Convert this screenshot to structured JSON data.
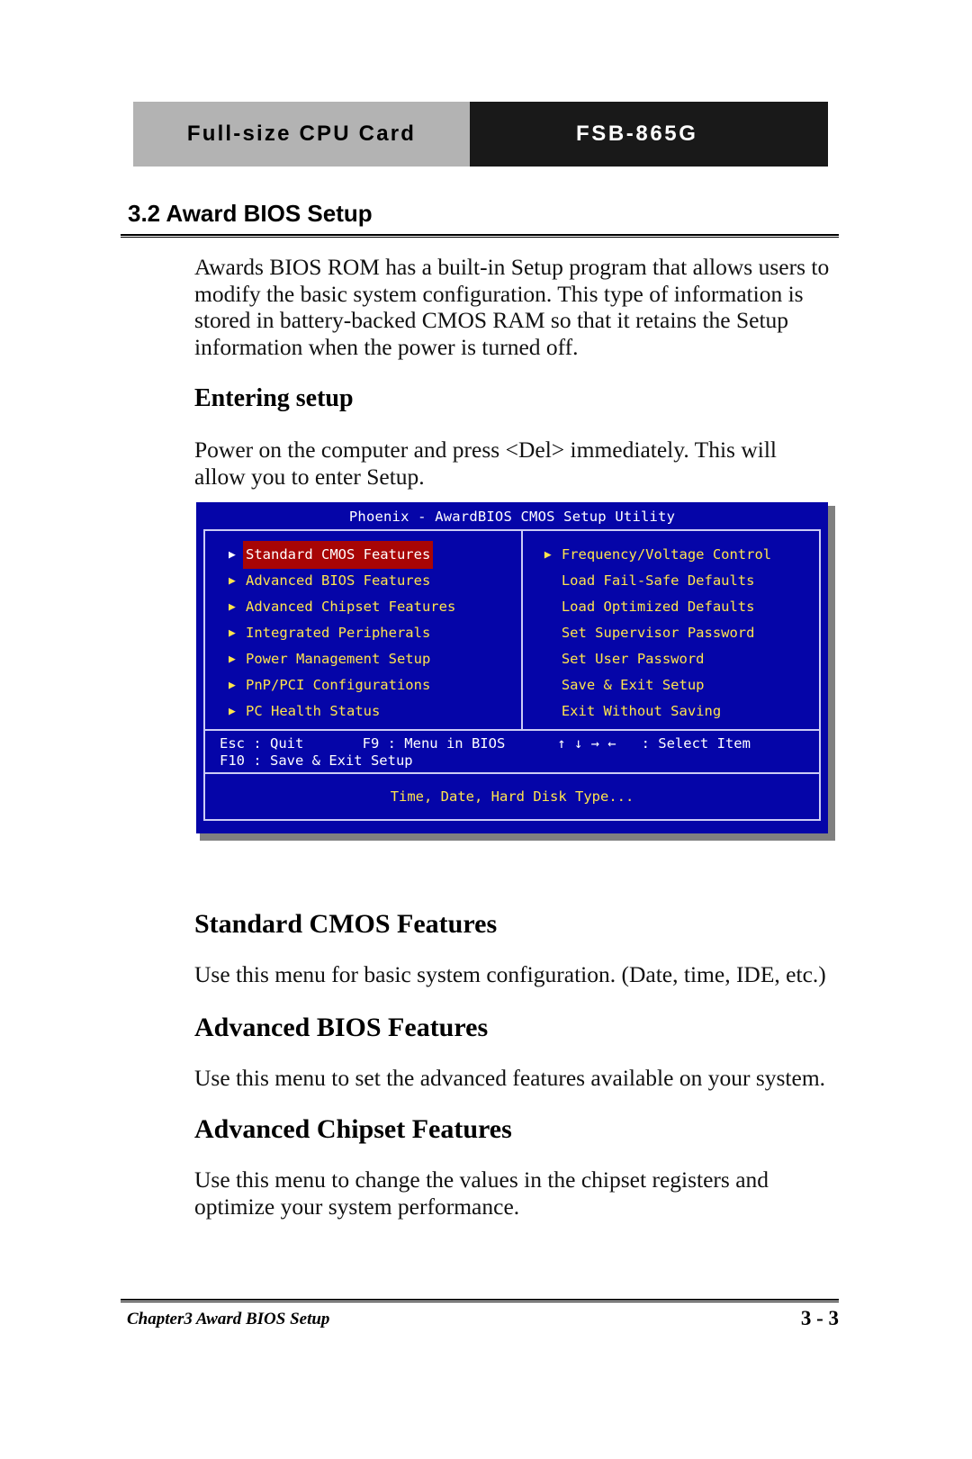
{
  "header": {
    "left_label": "Full-size CPU Card",
    "right_label": "FSB-865G",
    "left_bg": "#b3b3b3",
    "right_bg": "#191919"
  },
  "section": {
    "number_title": "3.2 Award BIOS Setup",
    "intro_paragraph": "Awards BIOS ROM has a built-in Setup program that allows users to modify the basic system configuration. This type of information is stored in battery-backed CMOS RAM so that it retains the Setup information when the power is turned off."
  },
  "entering_setup": {
    "heading": "Entering setup",
    "paragraph": "Power on the computer and press <Del> immediately. This will allow you to enter Setup."
  },
  "bios_screen": {
    "title": "Phoenix - AwardBIOS CMOS Setup Utility",
    "selected_item": "Standard CMOS Features",
    "colors": {
      "background": "#0505a8",
      "border": "#ccccf5",
      "item_text": "#ffe44d",
      "highlight_bg": "#a80505",
      "highlight_text": "#ffffff",
      "help_text": "#ffffff"
    },
    "left_column": [
      {
        "label": "Standard CMOS Features",
        "arrow": true,
        "selected": true
      },
      {
        "label": "Advanced BIOS Features",
        "arrow": true,
        "selected": false
      },
      {
        "label": "Advanced Chipset Features",
        "arrow": true,
        "selected": false
      },
      {
        "label": "Integrated Peripherals",
        "arrow": true,
        "selected": false
      },
      {
        "label": "Power Management Setup",
        "arrow": true,
        "selected": false
      },
      {
        "label": "PnP/PCI Configurations",
        "arrow": true,
        "selected": false
      },
      {
        "label": "PC Health Status",
        "arrow": true,
        "selected": false
      }
    ],
    "right_column": [
      {
        "label": "Frequency/Voltage Control",
        "arrow": true,
        "selected": false
      },
      {
        "label": "Load Fail-Safe Defaults",
        "arrow": false,
        "selected": false
      },
      {
        "label": "Load Optimized Defaults",
        "arrow": false,
        "selected": false
      },
      {
        "label": "Set Supervisor Password",
        "arrow": false,
        "selected": false
      },
      {
        "label": "Set User Password",
        "arrow": false,
        "selected": false
      },
      {
        "label": "Save & Exit Setup",
        "arrow": false,
        "selected": false
      },
      {
        "label": "Exit Without Saving",
        "arrow": false,
        "selected": false
      }
    ],
    "help_line_1": "Esc : Quit       F9 : Menu in BIOS",
    "help_line_2": "F10 : Save & Exit Setup",
    "help_keys": "↑ ↓ → ←   : Select Item",
    "description": "Time, Date, Hard Disk Type..."
  },
  "topics": [
    {
      "heading": "Standard CMOS Features",
      "paragraph": "Use this menu for basic system configuration. (Date, time, IDE, etc.)"
    },
    {
      "heading": "Advanced BIOS Features",
      "paragraph": "Use this menu to set the advanced features available on your system."
    },
    {
      "heading": "Advanced Chipset Features",
      "paragraph": "Use this menu to change the values in the chipset registers and optimize your system performance."
    }
  ],
  "footer": {
    "left": "Chapter3 Award BIOS Setup",
    "page_number": "3 - 3"
  }
}
